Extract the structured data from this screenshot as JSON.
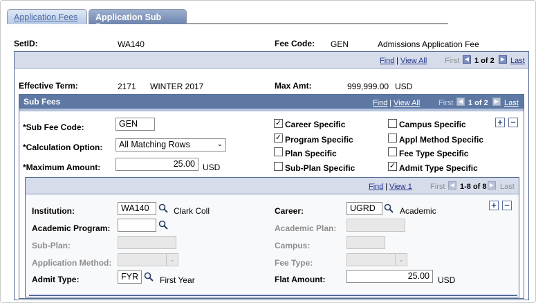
{
  "tabs": {
    "fees_label": "Application Fees",
    "sub_fees_label": "Application Sub Fees"
  },
  "header": {
    "setid_label": "SetID:",
    "setid_value": "WA140",
    "fee_code_label": "Fee Code:",
    "fee_code_value": "GEN",
    "fee_desc": "Admissions Application Fee"
  },
  "nav": {
    "find": "Find",
    "sep": "|",
    "view_all": "View All",
    "first": "First",
    "last": "Last",
    "outer_count": "1 of 2",
    "sub_count": "1 of 2",
    "inner_view": "View 1",
    "inner_count": "1-8 of 8"
  },
  "term": {
    "label": "Effective Term:",
    "code": "2171",
    "desc": "WINTER 2017",
    "max_label": "Max Amt:",
    "max_value": "999,999.00",
    "max_currency": "USD"
  },
  "sub_fees": {
    "title": "Sub Fees",
    "sub_fee_code_label": "*Sub Fee Code:",
    "sub_fee_code_value": "GEN",
    "calc_label": "*Calculation Option:",
    "calc_value": "All Matching Rows",
    "max_amt_label": "*Maximum Amount:",
    "max_amt_value": "25.00",
    "max_amt_currency": "USD",
    "checkboxes": {
      "career": "Career Specific",
      "program": "Program Specific",
      "plan": "Plan Specific",
      "subplan": "Sub-Plan Specific",
      "campus": "Campus Specific",
      "appl_method": "Appl Method Specific",
      "fee_type": "Fee Type Specific",
      "admit_type": "Admit Type Specific"
    },
    "check_mark": "✓"
  },
  "detail": {
    "institution_label": "Institution:",
    "institution_value": "WA140",
    "institution_desc": "Clark Coll",
    "career_label": "Career:",
    "career_value": "UGRD",
    "career_desc": "Academic",
    "program_label": "Academic Program:",
    "plan_label": "Academic Plan:",
    "subplan_label": "Sub-Plan:",
    "campus_label": "Campus:",
    "method_label": "Application Method:",
    "fee_type_label": "Fee Type:",
    "admit_label": "Admit Type:",
    "admit_value": "FYR",
    "admit_desc": "First Year",
    "flat_label": "Flat Amount:",
    "flat_value": "25.00",
    "flat_currency": "USD"
  },
  "icons": {
    "plus": "+",
    "minus": "−",
    "left_arrow": "◀",
    "right_arrow": "▶",
    "chevron": "⌄"
  },
  "colors": {
    "header_blue": "#5e78a4",
    "nav_band": "#d6dcea",
    "link": "#23338c"
  }
}
